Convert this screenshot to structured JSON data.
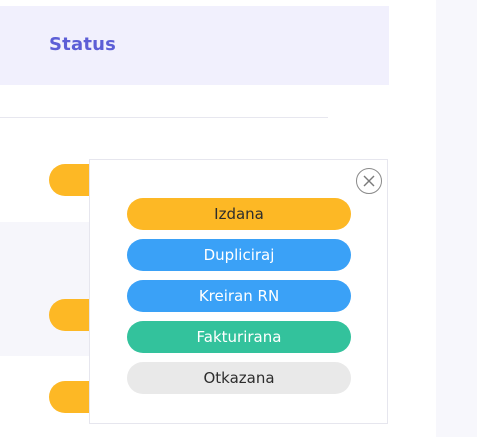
{
  "header": {
    "title": "Status"
  },
  "popup": {
    "close_icon": "close-icon",
    "options": [
      {
        "label": "Izdana",
        "color": "#fdb825",
        "text_color": "#2d2d2d"
      },
      {
        "label": "Dupliciraj",
        "color": "#3aa1f7",
        "text_color": "#ffffff"
      },
      {
        "label": "Kreiran RN",
        "color": "#3aa1f7",
        "text_color": "#ffffff"
      },
      {
        "label": "Fakturirana",
        "color": "#33c29c",
        "text_color": "#ffffff"
      },
      {
        "label": "Otkazana",
        "color": "#e9e9e9",
        "text_color": "#2d2d2d"
      }
    ]
  },
  "colors": {
    "accent": "#5c5ed6",
    "status_pill_background": "#fdb825"
  }
}
